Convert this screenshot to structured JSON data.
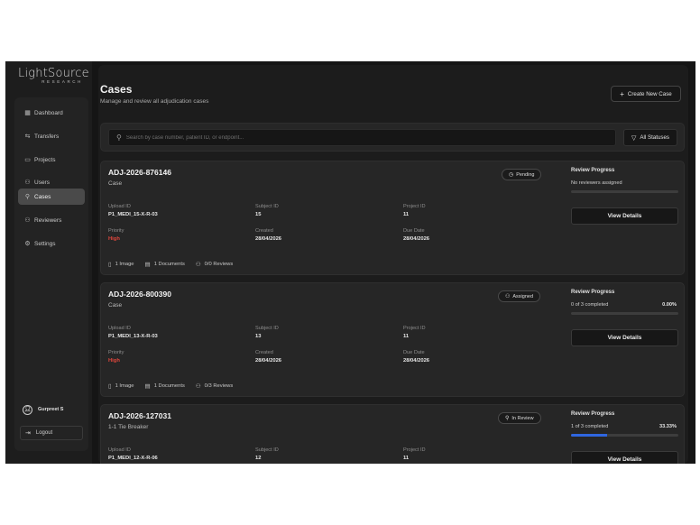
{
  "logo": {
    "main": "LightSource",
    "sub": "RESEARCH"
  },
  "nav": [
    {
      "label": "Dashboard",
      "icon": "grid-icon",
      "glyph": "▦"
    },
    {
      "label": "Transfers",
      "icon": "transfer-icon",
      "glyph": "⇆"
    },
    {
      "label": "Projects",
      "icon": "briefcase-icon",
      "glyph": "▭"
    },
    {
      "label": "Users",
      "icon": "users-icon",
      "glyph": "⚇"
    },
    {
      "label": "Cases",
      "icon": "cases-icon",
      "glyph": "⚲"
    },
    {
      "label": "Reviewers",
      "icon": "reviewers-icon",
      "glyph": "⚇"
    },
    {
      "label": "Settings",
      "icon": "gear-icon",
      "glyph": "⚙"
    }
  ],
  "user": {
    "name": "Gurpreet S",
    "logout": "Logout"
  },
  "header": {
    "title": "Cases",
    "subtitle": "Manage and review all adjudication cases",
    "create_label": "Create New Case"
  },
  "search": {
    "placeholder": "Search by case number, patient ID, or endpoint...",
    "filter_label": "All Statuses"
  },
  "labels": {
    "upload_id": "Upload ID",
    "subject_id": "Subject ID",
    "project_id": "Project ID",
    "priority": "Priority",
    "created": "Created",
    "due_date": "Due Date",
    "review_progress": "Review Progress",
    "view_details": "View Details"
  },
  "cases": [
    {
      "id": "ADJ-2026-876146",
      "type": "Case",
      "status": "Pending",
      "status_icon": "clock-icon",
      "upload_id": "P1_MEDI_15-X-R-03",
      "subject_id": "15",
      "project_id": "11",
      "priority": "High",
      "created": "28/04/2026",
      "due_date": "28/04/2026",
      "images": "1 Image",
      "documents": "1 Documents",
      "reviews": "0/0 Reviews",
      "progress_text": "No reviewers assigned",
      "progress_pct": "",
      "progress": 0
    },
    {
      "id": "ADJ-2026-800390",
      "type": "Case",
      "status": "Assigned",
      "status_icon": "users-icon",
      "upload_id": "P1_MEDI_13-X-R-03",
      "subject_id": "13",
      "project_id": "11",
      "priority": "High",
      "created": "28/04/2026",
      "due_date": "28/04/2026",
      "images": "1 Image",
      "documents": "1 Documents",
      "reviews": "0/3 Reviews",
      "progress_text": "0 of 3 completed",
      "progress_pct": "0.00%",
      "progress": 0
    },
    {
      "id": "ADJ-2026-127031",
      "type": "1-1 Tie Breaker",
      "status": "In Review",
      "status_icon": "search-icon",
      "upload_id": "P1_MEDI_12-X-R-06",
      "subject_id": "12",
      "project_id": "11",
      "priority": "",
      "created": "",
      "due_date": "",
      "images": "",
      "documents": "",
      "reviews": "",
      "progress_text": "1 of 3 completed",
      "progress_pct": "33.33%",
      "progress": 0.3333
    }
  ]
}
